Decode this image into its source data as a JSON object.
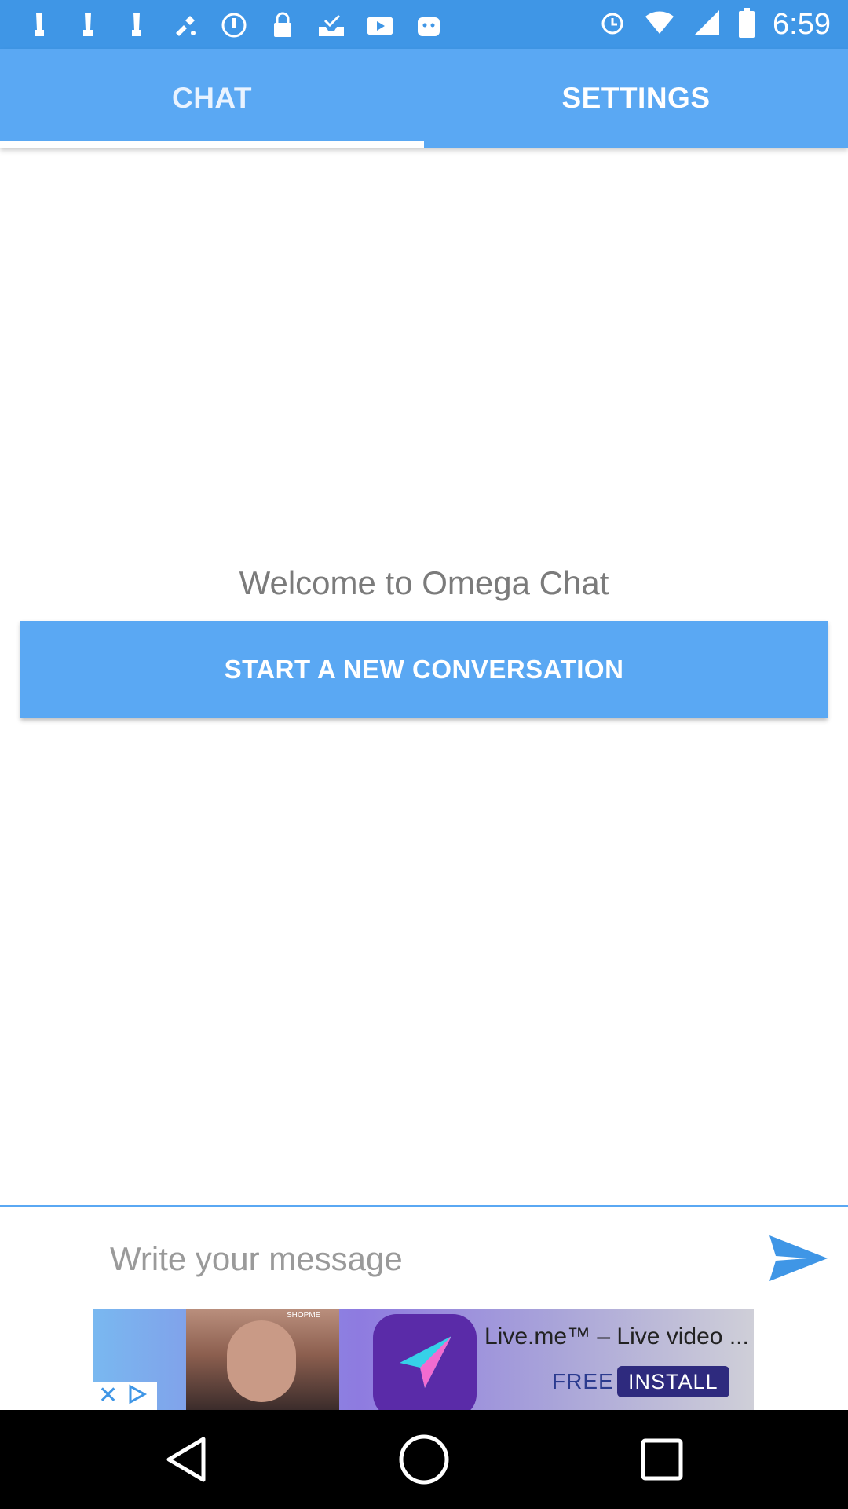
{
  "status_bar": {
    "time": "6:59",
    "left_icons": [
      "notification-icon",
      "notification-icon",
      "notification-icon",
      "fake-gps-icon",
      "alarm-clock-icon",
      "lock-icon",
      "inbox-check-icon",
      "youtube-icon",
      "android-robot-icon"
    ],
    "right_icons": [
      "alarm-icon",
      "wifi-icon",
      "signal-icon",
      "battery-icon"
    ]
  },
  "tabs": [
    {
      "label": "CHAT",
      "selected": true
    },
    {
      "label": "SETTINGS",
      "selected": false
    }
  ],
  "main": {
    "welcome_text": "Welcome to Omega Chat",
    "start_button_label": "START A NEW CONVERSATION"
  },
  "composer": {
    "placeholder": "Write your message",
    "value": "",
    "send_icon": "send-icon"
  },
  "ad": {
    "title": "Live.me™ – Live video ...",
    "free_label": "FREE",
    "install_label": "INSTALL",
    "photo_tag": "SHOPME"
  },
  "colors": {
    "status_bar": "#3f96e6",
    "tab_bar": "#5aa8f3",
    "accent": "#5aa8f3",
    "welcome_text": "#7b7b7b"
  }
}
